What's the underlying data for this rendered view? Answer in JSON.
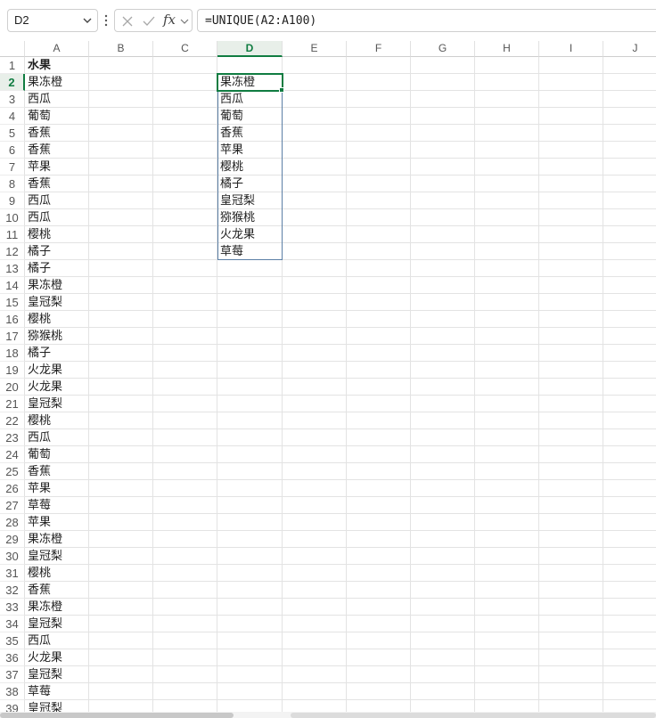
{
  "name_box": {
    "value": "D2"
  },
  "formula_bar": {
    "fx_label": "fx",
    "formula": "=UNIQUE(A2:A100)"
  },
  "columns": [
    "A",
    "B",
    "C",
    "D",
    "E",
    "F",
    "G",
    "H",
    "I",
    "J"
  ],
  "active_cell": {
    "column": "D",
    "row": 2
  },
  "rows": [
    "1",
    "2",
    "3",
    "4",
    "5",
    "6",
    "7",
    "8",
    "9",
    "10",
    "11",
    "12",
    "13",
    "14",
    "15",
    "16",
    "17",
    "18",
    "19",
    "20",
    "21",
    "22",
    "23",
    "24",
    "25",
    "26",
    "27",
    "28",
    "29",
    "30",
    "31",
    "32",
    "33",
    "34",
    "35",
    "36",
    "37",
    "38",
    "39"
  ],
  "column_a": {
    "header": "水果",
    "values": [
      "果冻橙",
      "西瓜",
      "葡萄",
      "香蕉",
      "香蕉",
      "苹果",
      "香蕉",
      "西瓜",
      "西瓜",
      "樱桃",
      "橘子",
      "橘子",
      "果冻橙",
      "皇冠梨",
      "樱桃",
      "猕猴桃",
      "橘子",
      "火龙果",
      "火龙果",
      "皇冠梨",
      "樱桃",
      "西瓜",
      "葡萄",
      "香蕉",
      "苹果",
      "草莓",
      "苹果",
      "果冻橙",
      "皇冠梨",
      "樱桃",
      "香蕉",
      "果冻橙",
      "皇冠梨",
      "西瓜",
      "火龙果",
      "皇冠梨",
      "草莓",
      "皇冠梨"
    ]
  },
  "column_d": {
    "values": [
      "果冻橙",
      "西瓜",
      "葡萄",
      "香蕉",
      "苹果",
      "樱桃",
      "橘子",
      "皇冠梨",
      "猕猴桃",
      "火龙果",
      "草莓"
    ]
  },
  "colors": {
    "accent": "#107c41",
    "spill_border": "#5b7fa6",
    "gridline": "#e3e3e3"
  }
}
